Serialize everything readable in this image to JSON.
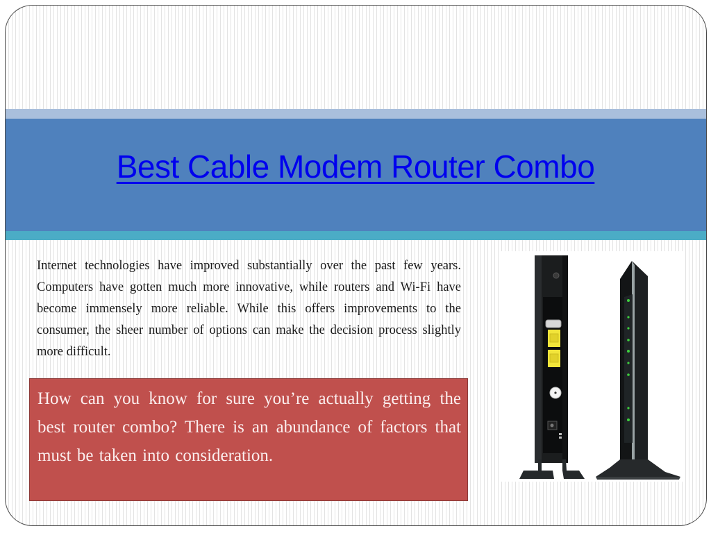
{
  "slide": {
    "title": "Best Cable Modem Router Combo",
    "intro_paragraph": "Internet technologies have improved substantially over the past few years. Computers have gotten much more innovative, while routers and Wi-Fi have become immensely more reliable. While this offers improvements to the consumer, the sheer number of options can make the decision process slightly more difficult.",
    "callout_paragraph": "How can you know for sure you’re actually getting the best router combo? There is an abundance of factors that must be taken into consideration.",
    "image": {
      "description": "Cable modem router combo shown from the back (ports) and from the side (status LEDs)",
      "back_view_ports": [
        "USB",
        "LAN1",
        "LAN2",
        "Cable",
        "Power"
      ],
      "side_view_led_count": 9
    },
    "colors": {
      "title_link": "#0000ee",
      "header_band": "#4f81bd",
      "header_band_top": "#a9bfdc",
      "header_band_bottom": "#4bacc6",
      "callout_fill": "#c0504d",
      "led_green": "#3fd13f"
    }
  }
}
